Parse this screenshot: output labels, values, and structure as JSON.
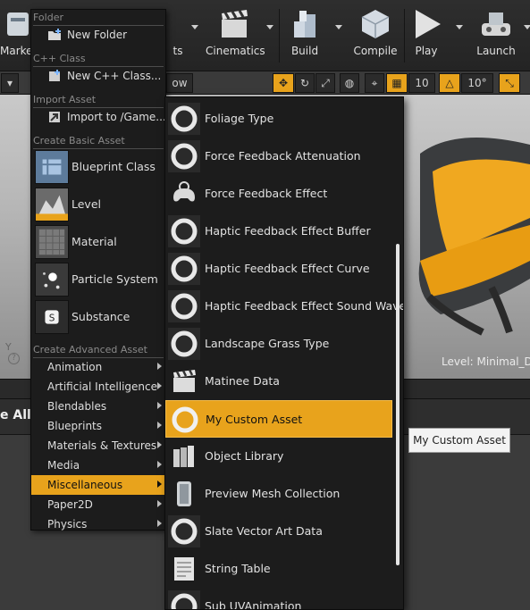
{
  "toolbar": {
    "marketplace_label": "Market",
    "cinematics_label": "Cinematics",
    "build_label": "Build",
    "compile_label": "Compile",
    "play_label": "Play",
    "launch_label": "Launch",
    "partial_label": "ts"
  },
  "viewport": {
    "show_fragment": "ow",
    "grid_snap_value": "10",
    "rotation_snap_value": "10°",
    "level_text": "Level:  Minimal_D"
  },
  "content_browser": {
    "save_all_fragment": "e All"
  },
  "menu": {
    "folder_header": "Folder",
    "new_folder": "New Folder",
    "cpp_header": "C++ Class",
    "new_cpp": "New C++ Class...",
    "import_header": "Import Asset",
    "import_to": "Import to /Game...",
    "basic_header": "Create Basic Asset",
    "basic_items": [
      {
        "label": "Blueprint Class",
        "icon": "blueprint-class-icon"
      },
      {
        "label": "Level",
        "icon": "level-icon"
      },
      {
        "label": "Material",
        "icon": "material-icon"
      },
      {
        "label": "Particle System",
        "icon": "particle-system-icon"
      },
      {
        "label": "Substance",
        "icon": "substance-icon"
      }
    ],
    "advanced_header": "Create Advanced Asset",
    "advanced_items": [
      {
        "label": "Animation"
      },
      {
        "label": "Artificial Intelligence"
      },
      {
        "label": "Blendables"
      },
      {
        "label": "Blueprints"
      },
      {
        "label": "Materials & Textures"
      },
      {
        "label": "Media"
      },
      {
        "label": "Miscellaneous",
        "selected": true
      },
      {
        "label": "Paper2D"
      },
      {
        "label": "Physics"
      }
    ]
  },
  "submenu": {
    "items": [
      {
        "label": "Foliage Type",
        "icon": "ring-icon"
      },
      {
        "label": "Force Feedback Attenuation",
        "icon": "ring-icon"
      },
      {
        "label": "Force Feedback Effect",
        "icon": "gamepad-icon"
      },
      {
        "label": "Haptic Feedback Effect Buffer",
        "icon": "ring-icon"
      },
      {
        "label": "Haptic Feedback Effect Curve",
        "icon": "ring-icon"
      },
      {
        "label": "Haptic Feedback Effect Sound Wave",
        "icon": "ring-icon"
      },
      {
        "label": "Landscape Grass Type",
        "icon": "ring-icon"
      },
      {
        "label": "Matinee Data",
        "icon": "clapperboard-icon"
      },
      {
        "label": "My Custom Asset",
        "icon": "ring-icon",
        "selected": true
      },
      {
        "label": "Object Library",
        "icon": "object-library-icon"
      },
      {
        "label": "Preview Mesh Collection",
        "icon": "mesh-collection-icon"
      },
      {
        "label": "Slate Vector Art Data",
        "icon": "ring-icon"
      },
      {
        "label": "String Table",
        "icon": "string-table-icon"
      },
      {
        "label": "Sub UVAnimation",
        "icon": "ring-icon"
      }
    ]
  },
  "tooltip": {
    "text": "My Custom Asset"
  },
  "colors": {
    "accent": "#e8a31c",
    "menu_bg": "#1c1c1c"
  }
}
